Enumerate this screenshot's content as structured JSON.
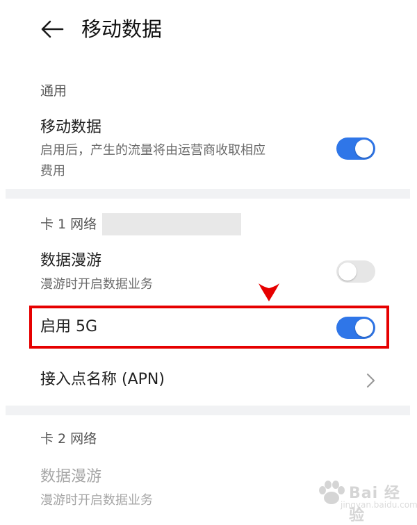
{
  "header": {
    "title": "移动数据"
  },
  "sections": {
    "general": {
      "label": "通用",
      "mobile_data": {
        "title": "移动数据",
        "description_line1": "启用后，产生的流量将由运营商收取相应",
        "description_line2": "费用",
        "enabled": true
      }
    },
    "card1": {
      "label": "卡 1 网络",
      "roaming": {
        "title": "数据漫游",
        "description": "漫游时开启数据业务",
        "enabled": false
      },
      "enable_5g": {
        "title": "启用 5G",
        "enabled": true
      },
      "apn": {
        "title": "接入点名称 (APN)"
      }
    },
    "card2": {
      "label": "卡 2 网络",
      "roaming": {
        "title": "数据漫游",
        "description": "漫游时开启数据业务"
      }
    }
  },
  "colors": {
    "toggle_on": "#2f76e8",
    "toggle_off": "#e6e6e6",
    "highlight": "#e60000"
  },
  "watermark": {
    "text": "Bai 经验",
    "subtext": "jingyan.baidu.com"
  }
}
